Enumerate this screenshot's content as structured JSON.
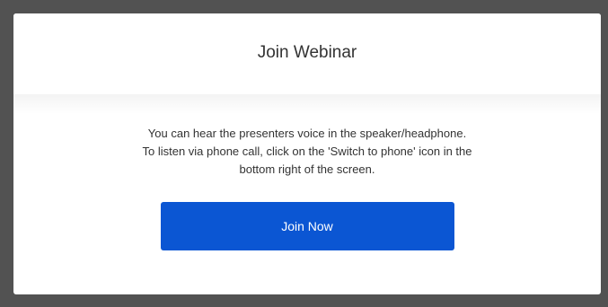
{
  "dialog": {
    "title": "Join Webinar",
    "message_lines": [
      "You can hear the presenters voice in the speaker/headphone.",
      "To listen via phone call, click on the 'Switch to phone' icon in the",
      "bottom right of the screen."
    ],
    "join_button_label": "Join Now"
  },
  "colors": {
    "backdrop": "#525252",
    "button_primary": "#0b56d3",
    "button_text": "#ffffff"
  }
}
